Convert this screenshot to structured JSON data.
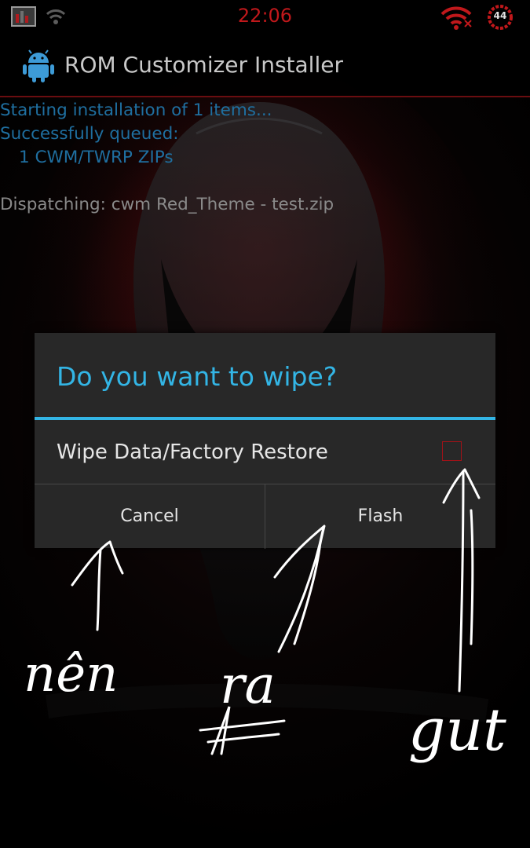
{
  "status_bar": {
    "time": "22:06",
    "battery_level": "44",
    "icons": [
      "app-notification-icon",
      "wifi-sync-icon",
      "wifi-icon",
      "battery-icon"
    ],
    "time_color": "#c0181b"
  },
  "action_bar": {
    "title": "ROM Customizer Installer",
    "icon": "android-icon"
  },
  "log": {
    "line1": "Starting installation of 1 items...",
    "line2": "Successfully queued:",
    "line3": "1 CWM/TWRP ZIPs",
    "line4": "Dispatching: cwm Red_Theme - test.zip"
  },
  "dialog": {
    "title": "Do you want to wipe?",
    "option_label": "Wipe Data/Factory Restore",
    "option_checked": false,
    "cancel_label": "Cancel",
    "flash_label": "Flash",
    "accent_color": "#33b5e5"
  },
  "annotations": {
    "note_cancel": "nên",
    "note_flash": "ra",
    "note_checkbox": "gut"
  }
}
